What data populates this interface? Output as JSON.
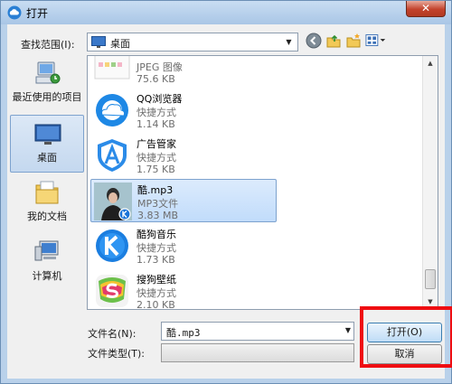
{
  "window": {
    "title": "打开",
    "close_label": "✕"
  },
  "lookin": {
    "label": "查找范围(I):",
    "value": "桌面"
  },
  "toolbar": {
    "back_icon": "back-icon",
    "up_icon": "up-folder-icon",
    "new_folder_icon": "new-folder-icon",
    "views_icon": "views-menu-icon"
  },
  "places": [
    {
      "label": "最近使用的项目",
      "icon": "recent-items-icon"
    },
    {
      "label": "桌面",
      "icon": "desktop-icon"
    },
    {
      "label": "我的文档",
      "icon": "documents-icon"
    },
    {
      "label": "计算机",
      "icon": "computer-icon"
    }
  ],
  "files": [
    {
      "name": "",
      "type": "JPEG 图像",
      "size": "75.6 KB"
    },
    {
      "name": "QQ浏览器",
      "type": "快捷方式",
      "size": "1.14 KB"
    },
    {
      "name": "广告管家",
      "type": "快捷方式",
      "size": "1.75 KB"
    },
    {
      "name": "酷.mp3",
      "type": "MP3文件",
      "size": "3.83 MB"
    },
    {
      "name": "酷狗音乐",
      "type": "快捷方式",
      "size": "1.73 KB"
    },
    {
      "name": "搜狗壁纸",
      "type": "快捷方式",
      "size": "2.10 KB"
    }
  ],
  "filename": {
    "label": "文件名(N):",
    "value": "酷.mp3"
  },
  "filetype": {
    "label": "文件类型(T):",
    "value": ""
  },
  "buttons": {
    "open": "打开(O)",
    "cancel": "取消"
  },
  "colors": {
    "accent": "#3c7fb1",
    "highlight": "#ef0d12"
  }
}
